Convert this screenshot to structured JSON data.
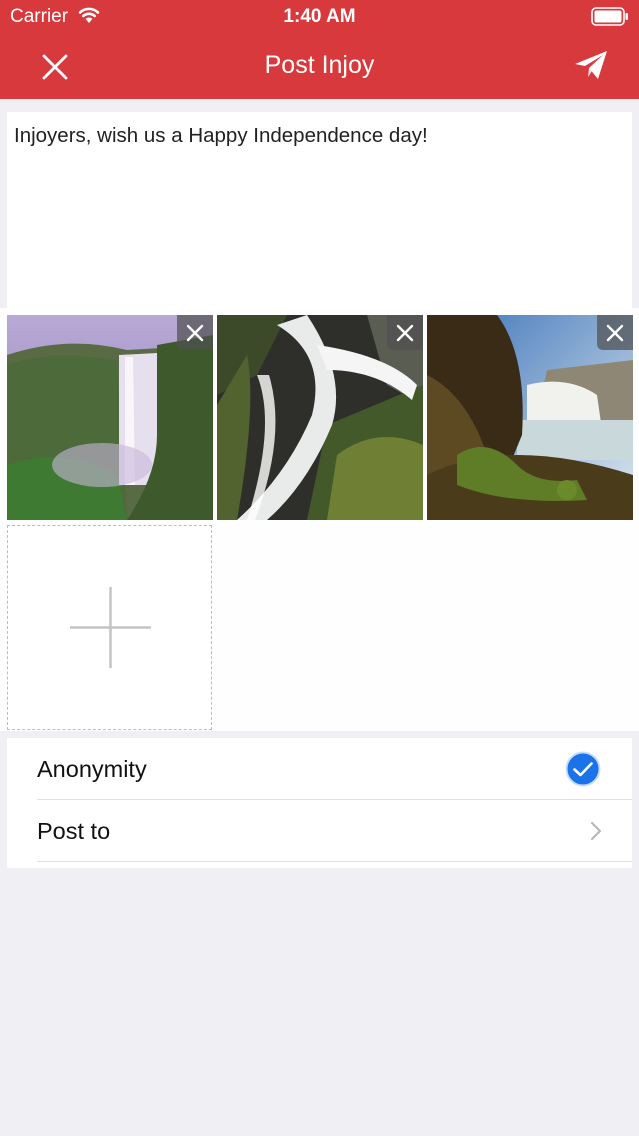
{
  "status_bar": {
    "carrier": "Carrier",
    "time": "1:40 AM"
  },
  "header": {
    "title": "Post Injoy",
    "close_icon": "close-icon",
    "send_icon": "send-paper-plane-icon"
  },
  "compose": {
    "text": "Injoyers, wish us a Happy Independence day!"
  },
  "media": {
    "photos": [
      {
        "subject": "waterfall-photo",
        "remove_icon": "close-icon"
      },
      {
        "subject": "waterfall-photo",
        "remove_icon": "close-icon"
      },
      {
        "subject": "waterfall-photo",
        "remove_icon": "close-icon"
      }
    ],
    "add_icon": "plus-icon"
  },
  "settings": {
    "anonymity_label": "Anonymity",
    "anonymity_checked": true,
    "post_to_label": "Post to"
  },
  "colors": {
    "header": "#d8393c",
    "accent": "#1a73e8",
    "background": "#efeff4"
  }
}
